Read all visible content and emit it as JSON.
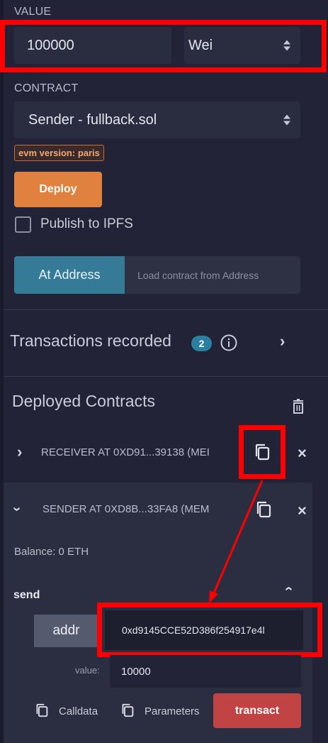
{
  "value_section": {
    "label": "VALUE",
    "amount": "100000",
    "unit": "Wei"
  },
  "contract_section": {
    "label": "CONTRACT",
    "selected": "Sender - fullback.sol",
    "evm_badge": "evm version: paris",
    "deploy_label": "Deploy",
    "publish_label": "Publish to IPFS",
    "publish_checked": false,
    "at_address_label": "At Address",
    "load_placeholder": "Load contract from Address"
  },
  "transactions": {
    "label": "Transactions recorded",
    "count": "2"
  },
  "deployed": {
    "title": "Deployed Contracts",
    "contracts": [
      {
        "name": "RECEIVER AT 0XD91...39138 (MEI",
        "expanded": false
      },
      {
        "name": "SENDER AT 0XD8B...33FA8 (MEM",
        "expanded": true
      }
    ],
    "balance": "Balance: 0 ETH",
    "function": {
      "name": "send",
      "param_label": "addr",
      "param_value": "0xd9145CCE52D386f254917e4l",
      "value_label": "value:",
      "value_amount": "10000",
      "calldata_label": "Calldata",
      "parameters_label": "Parameters",
      "transact_label": "transact"
    }
  },
  "colors": {
    "background": "#222336",
    "deploy": "#e0813f",
    "at_address": "#357a96",
    "transact": "#c14343",
    "badge_border": "#c96a3c",
    "highlight": "#ff0000"
  }
}
